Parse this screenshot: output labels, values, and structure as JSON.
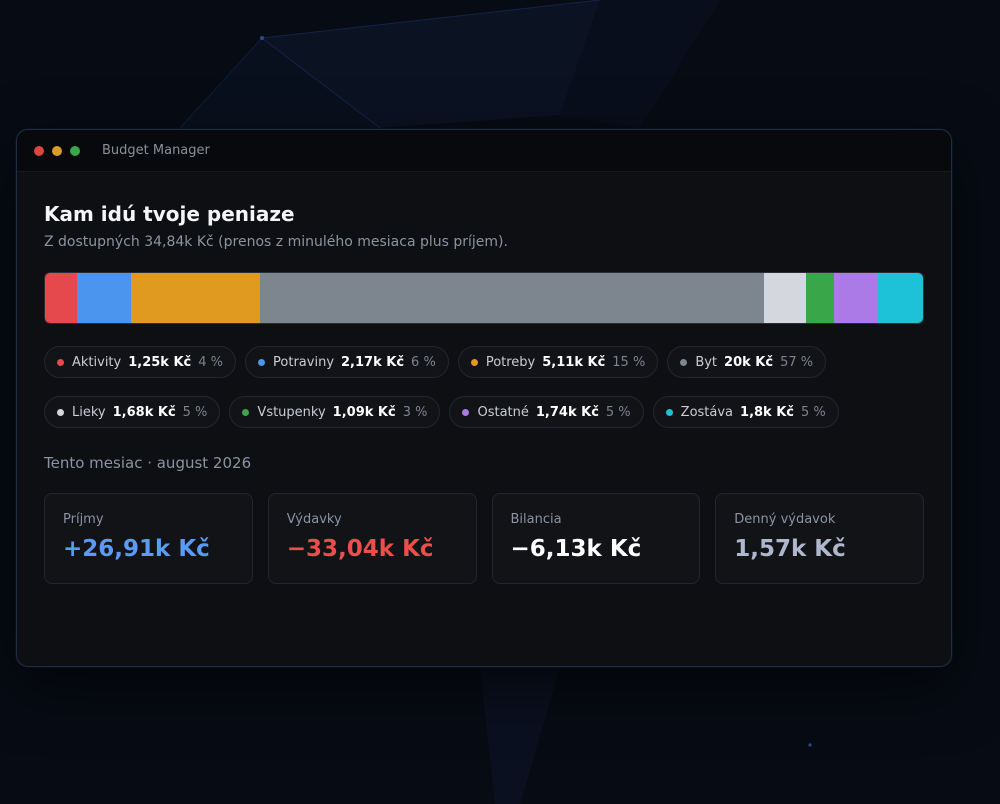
{
  "window": {
    "title": "Budget Manager"
  },
  "traffic_lights": [
    "#d9473f",
    "#d99a2a",
    "#3aa64a"
  ],
  "main": {
    "heading": "Kam idú tvoje peniaze",
    "subtitle": "Z dostupných 34,84k Kč (prenos z minulého mesiaca plus príjem).",
    "month_label": "Tento mesiac · august 2026"
  },
  "categories": [
    {
      "label": "Aktivity",
      "value": "1,25k Kč",
      "percent": "4 %",
      "amount": 1.25,
      "color": "#e5484d"
    },
    {
      "label": "Potraviny",
      "value": "2,17k Kč",
      "percent": "6 %",
      "amount": 2.17,
      "color": "#4c95ef"
    },
    {
      "label": "Potreby",
      "value": "5,11k Kč",
      "percent": "15 %",
      "amount": 5.11,
      "color": "#e09a20"
    },
    {
      "label": "Byt",
      "value": "20k Kč",
      "percent": "57 %",
      "amount": 20.0,
      "color": "#7d868e"
    },
    {
      "label": "Lieky",
      "value": "1,68k Kč",
      "percent": "5 %",
      "amount": 1.68,
      "color": "#d4d7dd"
    },
    {
      "label": "Vstupenky",
      "value": "1,09k Kč",
      "percent": "3 %",
      "amount": 1.09,
      "color": "#3aa64a"
    },
    {
      "label": "Ostatné",
      "value": "1,74k Kč",
      "percent": "5 %",
      "amount": 1.74,
      "color": "#ac7ae6"
    },
    {
      "label": "Zostáva",
      "value": "1,8k Kč",
      "percent": "5 %",
      "amount": 1.8,
      "color": "#1ec2d8"
    }
  ],
  "stats": [
    {
      "label": "Príjmy",
      "value": "+26,91k Kč",
      "color": "#5a9bf6"
    },
    {
      "label": "Výdavky",
      "value": "−33,04k Kč",
      "color": "#ef4c4c"
    },
    {
      "label": "Bilancia",
      "value": "−6,13k Kč",
      "color": "#ffffff"
    },
    {
      "label": "Denný výdavok",
      "value": "1,57k Kč",
      "color": "#aeb7cc"
    }
  ]
}
